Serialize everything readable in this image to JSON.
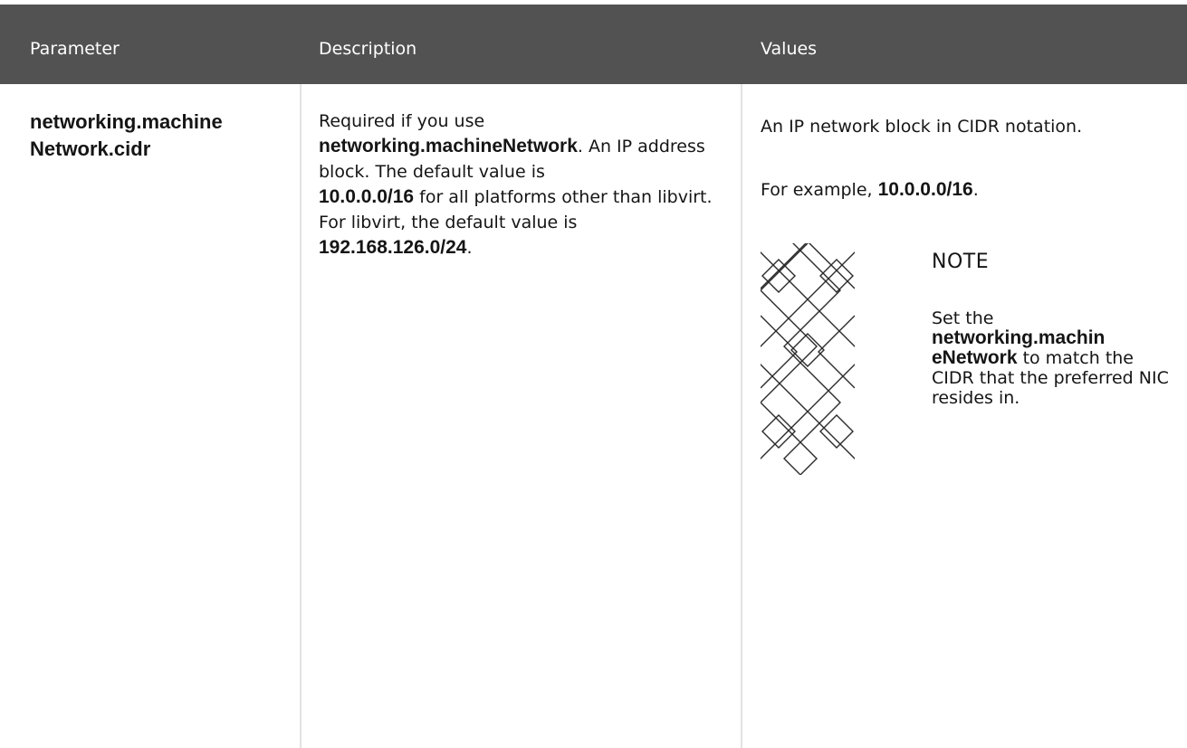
{
  "table": {
    "headers": {
      "parameter": "Parameter",
      "description": "Description",
      "values": "Values"
    },
    "row": {
      "parameter": {
        "line1": "networking.machine",
        "line2": "Network.cidr"
      },
      "description": {
        "t1": "Required if you use",
        "b1": "networking.machineNetwork",
        "t2": ". An IP address block. The default value is",
        "b2": "10.0.0.0/16",
        "t3": " for all platforms other than libvirt. For libvirt, the default value is ",
        "b3": "192.168.126.0/24",
        "t4": "."
      },
      "values": {
        "p1": "An IP network block in CIDR notation.",
        "p2_text": "For example, ",
        "p2_bold": "10.0.0.0/16",
        "p2_end": ".",
        "note": {
          "title": "NOTE",
          "t1": "Set the",
          "b1": "networking.machin",
          "b2": "eNetwork",
          "t2": " to match the CIDR that the preferred NIC resides in."
        }
      }
    }
  }
}
